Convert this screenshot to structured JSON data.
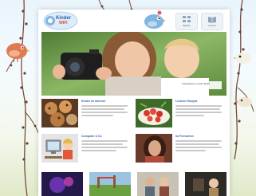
{
  "site": {
    "logo_line1": "Kinder",
    "logo_line2": "WIFI"
  },
  "nav": {
    "items": [
      {
        "label": "Spielen",
        "icon": "grid-icon"
      },
      {
        "label": "Lernen",
        "icon": "book-icon"
      }
    ]
  },
  "hero": {
    "caption": "Fotografieren macht Spaß"
  },
  "cards": [
    {
      "title": "Kinder im Internet",
      "image": "cookies-photo"
    },
    {
      "title": "Leckere Rezepte",
      "image": "fruit-plate-photo"
    },
    {
      "title": "Computer & Co",
      "image": "computer-cartoon"
    },
    {
      "title": "Im Fernsehen",
      "image": "girl-portrait-photo"
    }
  ],
  "colors": {
    "accent": "#2a5fa8",
    "bird_orange": "#e07a52",
    "bird_blue": "#7fb6e0"
  }
}
